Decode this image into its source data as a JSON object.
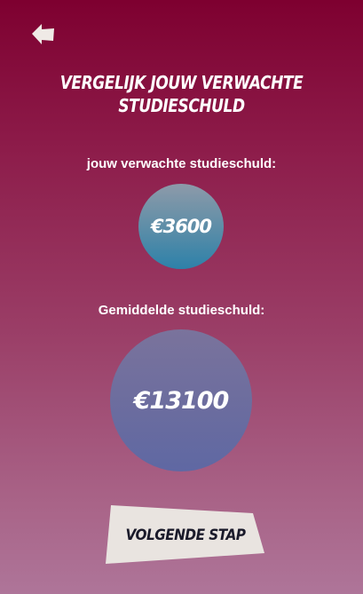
{
  "header": {
    "back_icon": "arrow-left-icon",
    "title_line1": "VERGELIJK JOUW VERWACHTE",
    "title_line2": "STUDIESCHULD"
  },
  "expected_debt": {
    "label": "jouw verwachte studieschuld:",
    "value": "€3600"
  },
  "average_debt": {
    "label": "Gemiddelde studieschuld:",
    "value": "€13100"
  },
  "actions": {
    "next_label": "VOLGENDE STAP"
  },
  "colors": {
    "background_top": "#7e0030",
    "background_bottom": "#ae7599",
    "expected_bubble": "#2d81a9",
    "average_bubble": "#6a6c9f",
    "button_fill": "#e9e4e0",
    "button_text": "#1a1a2a"
  }
}
